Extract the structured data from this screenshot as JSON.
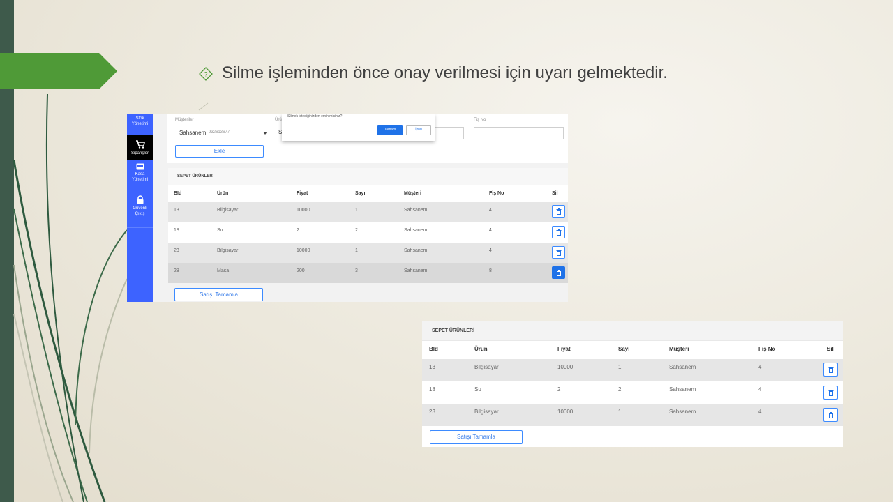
{
  "slide": {
    "bullet_text": "Silme işleminden önce onay verilmesi için uyarı gelmektedir."
  },
  "app": {
    "sidebar": [
      {
        "label_1": "Stok",
        "label_2": "Yönetimi",
        "icon": "none",
        "active": false
      },
      {
        "label_1": "Siparişler",
        "label_2": "",
        "icon": "cart-icon",
        "active": true
      },
      {
        "label_1": "Kasa",
        "label_2": "Yönetimi",
        "icon": "register-icon",
        "active": false
      },
      {
        "label_1": "Güvenli",
        "label_2": "Çıkış",
        "icon": "lock-icon",
        "active": false
      }
    ],
    "form": {
      "customers_label": "Müşteriler",
      "customer_value": "Sahsanem",
      "customer_phone": "932613677",
      "product_label": "Ürü",
      "product_value": "S",
      "fis_label": "Fiş No",
      "add_label": "Ekle"
    },
    "dialog": {
      "message": "Silmek istediğinizden emin misiniz?",
      "ok_label": "Tamam",
      "cancel_label": "İptal"
    },
    "basket_title": "SEPET ÜRÜNLERİ",
    "columns": [
      "BId",
      "Ürün",
      "Fiyat",
      "Sayı",
      "Müşteri",
      "Fiş No",
      "Sil"
    ],
    "complete_label": "Satışı Tamamla"
  },
  "table1": {
    "rows": [
      {
        "bid": "13",
        "urun": "Bilgisayar",
        "fiyat": "10000",
        "sayi": "1",
        "musteri": "Sahsanem",
        "fis": "4"
      },
      {
        "bid": "18",
        "urun": "Su",
        "fiyat": "2",
        "sayi": "2",
        "musteri": "Sahsanem",
        "fis": "4"
      },
      {
        "bid": "23",
        "urun": "Bilgisayar",
        "fiyat": "10000",
        "sayi": "1",
        "musteri": "Sahsanem",
        "fis": "4"
      },
      {
        "bid": "28",
        "urun": "Masa",
        "fiyat": "200",
        "sayi": "3",
        "musteri": "Sahsanem",
        "fis": "8"
      }
    ]
  },
  "table2": {
    "rows": [
      {
        "bid": "13",
        "urun": "Bilgisayar",
        "fiyat": "10000",
        "sayi": "1",
        "musteri": "Sahsanem",
        "fis": "4"
      },
      {
        "bid": "18",
        "urun": "Su",
        "fiyat": "2",
        "sayi": "2",
        "musteri": "Sahsanem",
        "fis": "4"
      },
      {
        "bid": "23",
        "urun": "Bilgisayar",
        "fiyat": "10000",
        "sayi": "1",
        "musteri": "Sahsanem",
        "fis": "4"
      }
    ]
  },
  "colors": {
    "sidebar": "#3d63ff",
    "accent": "#1f72e8",
    "title_arrow": "#4f9a37",
    "left_strip": "#3e5a4b"
  }
}
